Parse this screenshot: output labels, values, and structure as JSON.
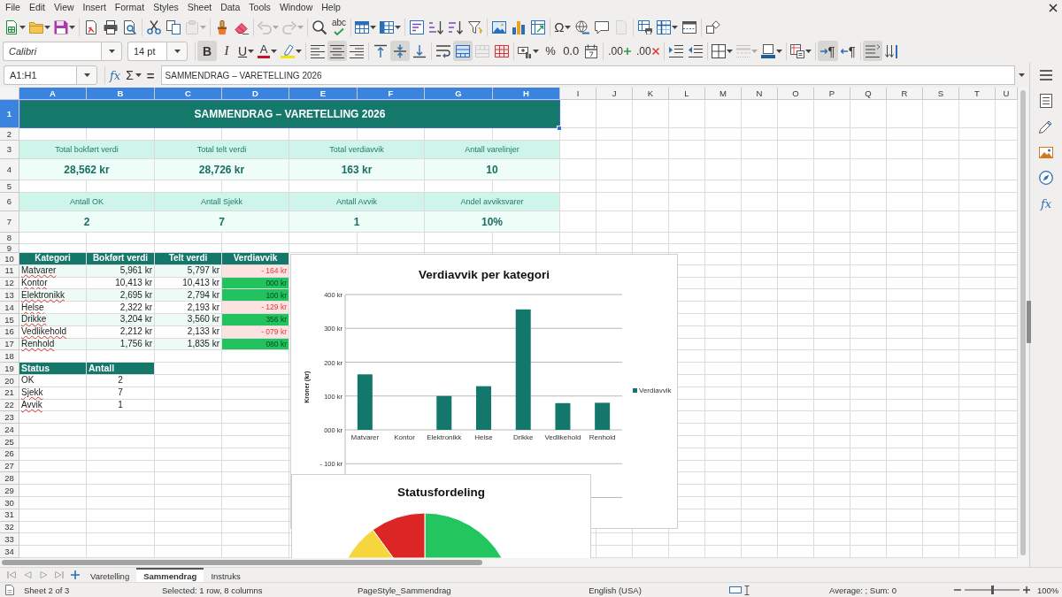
{
  "menu_bar": {
    "items": [
      "File",
      "Edit",
      "View",
      "Insert",
      "Format",
      "Styles",
      "Sheet",
      "Data",
      "Tools",
      "Window",
      "Help"
    ]
  },
  "standard_toolbar": {
    "groups": [
      [
        {
          "dropdown": true,
          "disabled": false
        },
        {
          "dropdown": true,
          "disabled": false
        },
        {
          "dropdown": true,
          "disabled": false
        }
      ],
      [
        {
          "dropdown": false,
          "disabled": false
        },
        {
          "dropdown": false,
          "disabled": false
        },
        {
          "dropdown": false,
          "disabled": false
        }
      ],
      [
        {
          "dropdown": false,
          "disabled": false
        },
        {
          "dropdown": false,
          "disabled": false
        },
        {
          "dropdown": true,
          "disabled": true
        }
      ],
      [
        {
          "dropdown": false,
          "disabled": false
        },
        {
          "dropdown": false,
          "disabled": false
        }
      ],
      [
        {
          "dropdown": true,
          "disabled": true
        },
        {
          "dropdown": true,
          "disabled": true
        }
      ],
      [
        {
          "dropdown": false,
          "disabled": false
        },
        {
          "label": "abc",
          "dropdown": false,
          "disabled": false
        }
      ],
      [
        {
          "dropdown": true,
          "disabled": false
        },
        {
          "dropdown": true,
          "disabled": false
        }
      ],
      [
        {
          "dropdown": false,
          "disabled": false
        },
        {
          "dropdown": false,
          "disabled": false
        },
        {
          "dropdown": false,
          "disabled": false
        },
        {
          "dropdown": false,
          "disabled": false
        }
      ],
      [
        {
          "dropdown": false,
          "disabled": false
        },
        {
          "dropdown": false,
          "disabled": false
        },
        {
          "dropdown": false,
          "disabled": false
        }
      ],
      [
        {
          "label": "Ω",
          "dropdown": true,
          "disabled": false
        },
        {
          "dropdown": false,
          "disabled": false
        },
        {
          "dropdown": false,
          "disabled": false
        },
        {
          "dropdown": false,
          "disabled": true
        }
      ],
      [
        {
          "dropdown": false,
          "disabled": false
        },
        {
          "dropdown": true,
          "disabled": false
        },
        {
          "dropdown": false,
          "disabled": false
        }
      ],
      [
        {
          "dropdown": false,
          "disabled": false
        }
      ]
    ]
  },
  "formatting_toolbar": {
    "font_name": "Calibri",
    "font_size": "14 pt",
    "groups": [
      [
        {
          "label": "B",
          "pressed": true,
          "dropdown": false,
          "disabled": false
        },
        {
          "label": "I",
          "pressed": false,
          "dropdown": false,
          "disabled": false
        },
        {
          "label": "U",
          "pressed": false,
          "dropdown": true,
          "disabled": false
        },
        {
          "label": "A",
          "pressed": false,
          "dropdown": true,
          "disabled": false
        },
        {
          "pressed": false,
          "dropdown": true,
          "disabled": false
        }
      ],
      [
        {
          "pressed": false,
          "dropdown": false,
          "disabled": false
        },
        {
          "pressed": true,
          "dropdown": false,
          "disabled": false
        },
        {
          "pressed": false,
          "dropdown": false,
          "disabled": false
        }
      ],
      [
        {
          "pressed": false,
          "dropdown": false,
          "disabled": false
        },
        {
          "pressed": true,
          "dropdown": false,
          "disabled": false
        },
        {
          "pressed": false,
          "dropdown": false,
          "disabled": false
        }
      ],
      [
        {
          "pressed": false,
          "dropdown": false,
          "disabled": false
        },
        {
          "pressed": true,
          "dropdown": false,
          "disabled": false
        },
        {
          "pressed": false,
          "dropdown": false,
          "disabled": true
        },
        {
          "pressed": false,
          "dropdown": false,
          "disabled": false
        }
      ],
      [
        {
          "pressed": false,
          "dropdown": true,
          "disabled": false
        },
        {
          "label": "%",
          "pressed": false,
          "dropdown": false,
          "disabled": false
        },
        {
          "label": "0.0",
          "pressed": false,
          "dropdown": false,
          "disabled": false
        },
        {
          "pressed": false,
          "dropdown": false,
          "disabled": false
        }
      ],
      [
        {
          "label": ".00",
          "pressed": false,
          "dropdown": false,
          "disabled": false
        },
        {
          "label": ".00",
          "pressed": false,
          "dropdown": false,
          "disabled": false
        }
      ],
      [
        {
          "pressed": false,
          "dropdown": false,
          "disabled": false
        },
        {
          "pressed": false,
          "dropdown": false,
          "disabled": false
        }
      ],
      [
        {
          "pressed": false,
          "dropdown": true,
          "disabled": false
        },
        {
          "pressed": false,
          "dropdown": true,
          "disabled": true
        },
        {
          "pressed": false,
          "dropdown": true,
          "disabled": false
        }
      ],
      [
        {
          "pressed": false,
          "dropdown": true,
          "disabled": false
        }
      ],
      [
        {
          "label": "¶",
          "pressed": true,
          "dropdown": false,
          "disabled": false
        },
        {
          "label": "¶",
          "pressed": false,
          "dropdown": false,
          "disabled": false
        }
      ],
      [
        {
          "pressed": true,
          "dropdown": false,
          "disabled": false
        },
        {
          "pressed": false,
          "dropdown": false,
          "disabled": false
        }
      ]
    ]
  },
  "formula_bar": {
    "name_box": "A1:H1",
    "function_label": "fx",
    "sum_label": "Σ",
    "equals_label": "=",
    "content": "SAMMENDRAG – VARETELLING 2026"
  },
  "sidebar": {
    "functions_label": "fx"
  },
  "sheet": {
    "columns": [
      {
        "label": "A",
        "selected": true
      },
      {
        "label": "B",
        "selected": true
      },
      {
        "label": "C",
        "selected": true
      },
      {
        "label": "D",
        "selected": true
      },
      {
        "label": "E",
        "selected": true
      },
      {
        "label": "F",
        "selected": true
      },
      {
        "label": "G",
        "selected": true
      },
      {
        "label": "H",
        "selected": true
      },
      {
        "label": "I",
        "selected": false
      },
      {
        "label": "J",
        "selected": false
      },
      {
        "label": "K",
        "selected": false
      },
      {
        "label": "L",
        "selected": false
      },
      {
        "label": "M",
        "selected": false
      },
      {
        "label": "N",
        "selected": false
      },
      {
        "label": "O",
        "selected": false
      },
      {
        "label": "P",
        "selected": false
      },
      {
        "label": "Q",
        "selected": false
      },
      {
        "label": "R",
        "selected": false
      },
      {
        "label": "S",
        "selected": false
      },
      {
        "label": "T",
        "selected": false
      },
      {
        "label": "U",
        "selected": false
      }
    ],
    "rows": [
      {
        "label": "1",
        "selected": true
      },
      {
        "label": "2",
        "selected": false
      },
      {
        "label": "3",
        "selected": false
      },
      {
        "label": "4",
        "selected": false
      },
      {
        "label": "5",
        "selected": false
      },
      {
        "label": "6",
        "selected": false
      },
      {
        "label": "7",
        "selected": false
      },
      {
        "label": "8",
        "selected": false
      },
      {
        "label": "9",
        "selected": false
      },
      {
        "label": "10",
        "selected": false
      },
      {
        "label": "11",
        "selected": false
      },
      {
        "label": "12",
        "selected": false
      },
      {
        "label": "13",
        "selected": false
      },
      {
        "label": "14",
        "selected": false
      },
      {
        "label": "15",
        "selected": false
      },
      {
        "label": "16",
        "selected": false
      },
      {
        "label": "17",
        "selected": false
      },
      {
        "label": "18",
        "selected": false
      },
      {
        "label": "19",
        "selected": false
      },
      {
        "label": "20",
        "selected": false
      },
      {
        "label": "21",
        "selected": false
      },
      {
        "label": "22",
        "selected": false
      },
      {
        "label": "23",
        "selected": false
      },
      {
        "label": "24",
        "selected": false
      },
      {
        "label": "25",
        "selected": false
      },
      {
        "label": "26",
        "selected": false
      },
      {
        "label": "27",
        "selected": false
      },
      {
        "label": "28",
        "selected": false
      },
      {
        "label": "29",
        "selected": false
      },
      {
        "label": "30",
        "selected": false
      },
      {
        "label": "31",
        "selected": false
      },
      {
        "label": "32",
        "selected": false
      },
      {
        "label": "33",
        "selected": false
      },
      {
        "label": "34",
        "selected": false
      }
    ],
    "title": {
      "text": "SAMMENDRAG – VARETELLING 2026",
      "selected": true
    },
    "summary": [
      [
        {
          "label": "Total bokført verdi",
          "value": "28,562 kr"
        },
        {
          "label": "Total telt verdi",
          "value": "28,726 kr"
        },
        {
          "label": "Total verdiavvik",
          "value": "163 kr"
        },
        {
          "label": "Antall varelinjer",
          "value": "10"
        }
      ],
      [
        {
          "label": "Antall OK",
          "value": "2"
        },
        {
          "label": "Antall Sjekk",
          "value": "7"
        },
        {
          "label": "Antall Avvik",
          "value": "1"
        },
        {
          "label": "Andel avviksvarer",
          "value": "10%"
        }
      ]
    ],
    "category_table": {
      "columns": [
        "Kategori",
        "Bokført verdi",
        "Telt verdi",
        "Verdiavvik"
      ],
      "rows": [
        {
          "cells": [
            "Matvarer",
            "5,961 kr",
            "5,797 kr",
            "- 164 kr"
          ],
          "negative": true,
          "misspelled": true
        },
        {
          "cells": [
            "Kontor",
            "10,413 kr",
            "10,413 kr",
            "000 kr"
          ],
          "negative": false,
          "misspelled": true
        },
        {
          "cells": [
            "Elektronikk",
            "2,695 kr",
            "2,794 kr",
            "100 kr"
          ],
          "negative": false,
          "misspelled": true
        },
        {
          "cells": [
            "Helse",
            "2,322 kr",
            "2,193 kr",
            "- 129 kr"
          ],
          "negative": true,
          "misspelled": true
        },
        {
          "cells": [
            "Drikke",
            "3,204 kr",
            "3,560 kr",
            "356 kr"
          ],
          "negative": false,
          "misspelled": true
        },
        {
          "cells": [
            "Vedlikehold",
            "2,212 kr",
            "2,133 kr",
            "- 079 kr"
          ],
          "negative": true,
          "misspelled": true
        },
        {
          "cells": [
            "Renhold",
            "1,756 kr",
            "1,835 kr",
            "080 kr"
          ],
          "negative": false,
          "misspelled": true
        }
      ]
    },
    "status_table": {
      "columns": [
        "Status",
        "Antall"
      ],
      "rows": [
        {
          "cells": [
            "OK",
            "2"
          ],
          "misspelled": false
        },
        {
          "cells": [
            "Sjekk",
            "7"
          ],
          "misspelled": true
        },
        {
          "cells": [
            "Avvik",
            "1"
          ],
          "misspelled": true
        }
      ]
    }
  },
  "bar_chart": {
    "chart_data": {
      "type": "bar",
      "title": "Verdiavvik per kategori",
      "ylabel": "Kroner (kr)",
      "categories": [
        "Matvarer",
        "Kontor",
        "Elektronikk",
        "Helse",
        "Drikke",
        "Vedlikehold",
        "Renhold"
      ],
      "series": [
        {
          "name": "Verdiavvik",
          "color": "#13776b",
          "values": [
            164,
            0,
            100,
            129,
            356,
            79,
            80
          ]
        }
      ],
      "ylim": [
        -200,
        400
      ],
      "yticks": [
        {
          "value": -100,
          "label": "- 100 kr"
        },
        {
          "value": 0,
          "label": "000 kr"
        },
        {
          "value": 100,
          "label": "100 kr"
        },
        {
          "value": 200,
          "label": "200 kr"
        },
        {
          "value": 300,
          "label": "300 kr"
        },
        {
          "value": 400,
          "label": "400 kr"
        }
      ],
      "grid": true
    }
  },
  "pie_chart": {
    "title": "Statusfordeling"
  },
  "sheet_tabs": [
    {
      "label": "Varetelling",
      "selected": false
    },
    {
      "label": "Sammendrag",
      "selected": true
    },
    {
      "label": "Instruks",
      "selected": false
    }
  ],
  "status_bar": {
    "sheet": "Sheet 2 of 3",
    "selection": "Selected: 1 row, 8 columns",
    "page_style": "PageStyle_Sammendrag",
    "language": "English (USA)",
    "summary": "Average: ; Sum: 0",
    "zoom": {
      "level": 0.5,
      "reading": "100%"
    }
  }
}
